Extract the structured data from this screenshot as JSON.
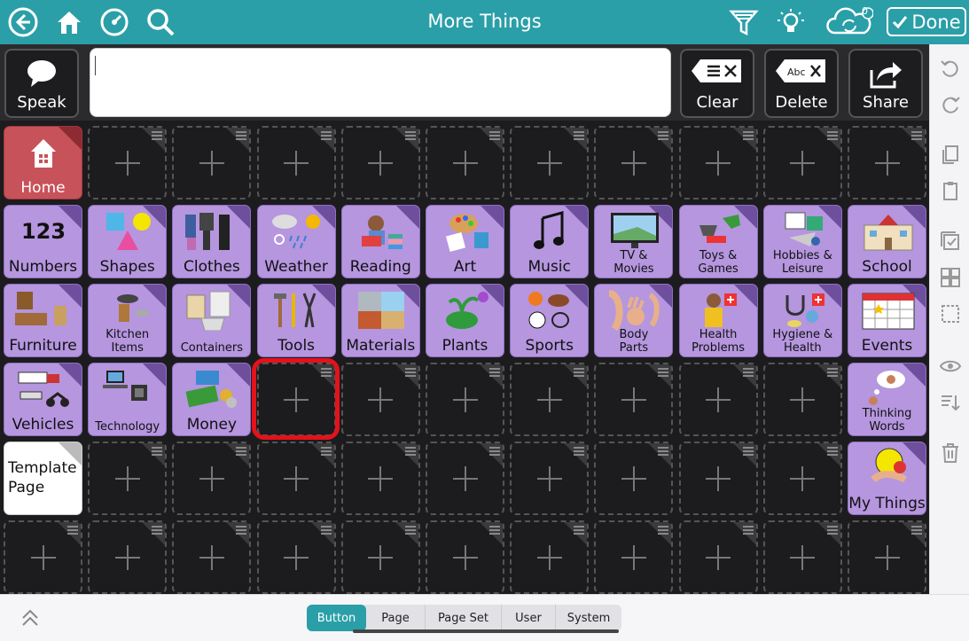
{
  "header": {
    "title": "More Things",
    "done_label": "Done",
    "sync_badge": "0",
    "icons": [
      "back-icon",
      "home-icon",
      "dashboard-icon",
      "search-icon",
      "filter-icon",
      "lightbulb-icon",
      "cloud-sync-icon"
    ]
  },
  "actions": {
    "speak": "Speak",
    "clear": "Clear",
    "delete": "Delete",
    "share": "Share"
  },
  "message": {
    "value": ""
  },
  "grid": {
    "row0": {
      "home": "Home"
    },
    "row1": [
      "Numbers",
      "Shapes",
      "Clothes",
      "Weather",
      "Reading",
      "Art",
      "Music",
      "TV & Movies",
      "Toys & Games",
      "Hobbies & Leisure",
      "School"
    ],
    "row2": [
      "Furniture",
      "Kitchen Items",
      "Containers",
      "Tools",
      "Materials",
      "Plants",
      "Sports",
      "Body Parts",
      "Health Problems",
      "Hygiene & Health",
      "Events"
    ],
    "row3": [
      "Vehicles",
      "Technology",
      "Money",
      "Thinking Words"
    ],
    "row4": [
      "Template Page",
      "My Things"
    ],
    "numbers_glyph": "123"
  },
  "sidebar_icons": [
    "undo-icon",
    "redo-icon",
    "copy-icon",
    "paste-icon",
    "select-icon",
    "multi-select-icon",
    "select-area-icon",
    "visibility-icon",
    "sort-icon",
    "trash-icon",
    "collapse-icon"
  ],
  "bottom": {
    "tabs": [
      "Button",
      "Page",
      "Page Set",
      "User",
      "System"
    ],
    "active_tab": "Button"
  },
  "colors": {
    "accent": "#2a9fa8",
    "folder": "#b596df",
    "home": "#c8525a",
    "highlight": "#e3121b"
  }
}
